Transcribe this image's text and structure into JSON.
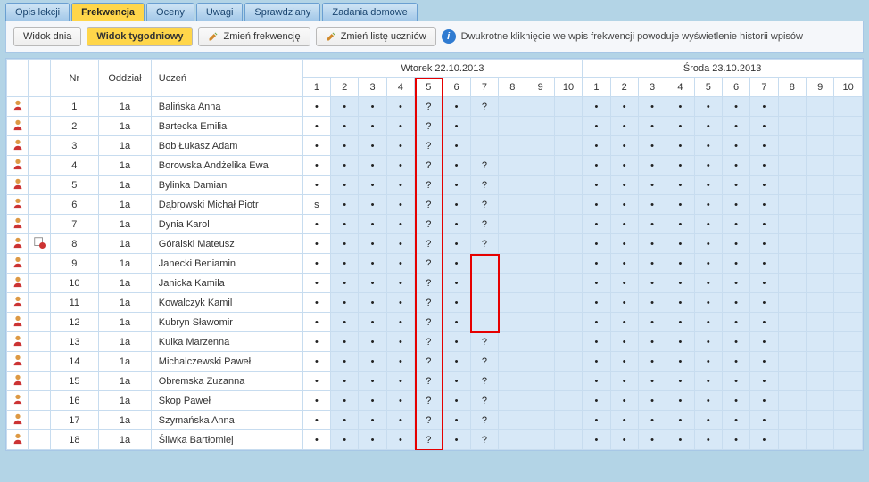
{
  "tabs": {
    "opis_lekcji": "Opis lekcji",
    "frekwencja": "Frekwencja",
    "oceny": "Oceny",
    "uwagi": "Uwagi",
    "sprawdziany": "Sprawdziany",
    "zadania_domowe": "Zadania domowe"
  },
  "toolbar": {
    "widok_dnia": "Widok dnia",
    "widok_tygodniowy": "Widok tygodniowy",
    "zmien_frekwencje": "Zmień frekwencję",
    "zmien_liste": "Zmień listę uczniów",
    "hint": "Dwukrotne kliknięcie we wpis frekwencji powoduje wyświetlenie historii wpisów"
  },
  "headers": {
    "nr": "Nr",
    "oddzial": "Oddział",
    "uczen": "Uczeń",
    "day1": "Wtorek 22.10.2013",
    "day2": "Środa 23.10.2013",
    "periods": [
      "1",
      "2",
      "3",
      "4",
      "5",
      "6",
      "7",
      "8",
      "9",
      "10"
    ]
  },
  "students": [
    {
      "nr": 1,
      "oddzial": "1a",
      "name": "Balińska Anna",
      "d1": [
        "•",
        "•",
        "•",
        "•",
        "?",
        "•",
        "?",
        "",
        "",
        ""
      ],
      "d2": [
        "•",
        "•",
        "•",
        "•",
        "•",
        "•",
        "•",
        "",
        "",
        ""
      ]
    },
    {
      "nr": 2,
      "oddzial": "1a",
      "name": "Bartecka Emilia",
      "d1": [
        "•",
        "•",
        "•",
        "•",
        "?",
        "•",
        "",
        "",
        "",
        ""
      ],
      "d2": [
        "•",
        "•",
        "•",
        "•",
        "•",
        "•",
        "•",
        "",
        "",
        ""
      ]
    },
    {
      "nr": 3,
      "oddzial": "1a",
      "name": "Bob Łukasz Adam",
      "d1": [
        "•",
        "•",
        "•",
        "•",
        "?",
        "•",
        "",
        "",
        "",
        ""
      ],
      "d2": [
        "•",
        "•",
        "•",
        "•",
        "•",
        "•",
        "•",
        "",
        "",
        ""
      ]
    },
    {
      "nr": 4,
      "oddzial": "1a",
      "name": "Borowska Andżelika Ewa",
      "d1": [
        "•",
        "•",
        "•",
        "•",
        "?",
        "•",
        "?",
        "",
        "",
        ""
      ],
      "d2": [
        "•",
        "•",
        "•",
        "•",
        "•",
        "•",
        "•",
        "",
        "",
        ""
      ]
    },
    {
      "nr": 5,
      "oddzial": "1a",
      "name": "Bylinka Damian",
      "d1": [
        "•",
        "•",
        "•",
        "•",
        "?",
        "•",
        "?",
        "",
        "",
        ""
      ],
      "d2": [
        "•",
        "•",
        "•",
        "•",
        "•",
        "•",
        "•",
        "",
        "",
        ""
      ]
    },
    {
      "nr": 6,
      "oddzial": "1a",
      "name": "Dąbrowski Michał Piotr",
      "d1": [
        "s",
        "•",
        "•",
        "•",
        "?",
        "•",
        "?",
        "",
        "",
        ""
      ],
      "d2": [
        "•",
        "•",
        "•",
        "•",
        "•",
        "•",
        "•",
        "",
        "",
        ""
      ]
    },
    {
      "nr": 7,
      "oddzial": "1a",
      "name": "Dynia Karol",
      "d1": [
        "•",
        "•",
        "•",
        "•",
        "?",
        "•",
        "?",
        "",
        "",
        ""
      ],
      "d2": [
        "•",
        "•",
        "•",
        "•",
        "•",
        "•",
        "•",
        "",
        "",
        ""
      ]
    },
    {
      "nr": 8,
      "oddzial": "1a",
      "name": "Góralski Mateusz",
      "d1": [
        "•",
        "•",
        "•",
        "•",
        "?",
        "•",
        "?",
        "",
        "",
        ""
      ],
      "d2": [
        "•",
        "•",
        "•",
        "•",
        "•",
        "•",
        "•",
        "",
        "",
        ""
      ],
      "flag": true
    },
    {
      "nr": 9,
      "oddzial": "1a",
      "name": "Janecki Beniamin",
      "d1": [
        "•",
        "•",
        "•",
        "•",
        "?",
        "•",
        "",
        "",
        "",
        ""
      ],
      "d2": [
        "•",
        "•",
        "•",
        "•",
        "•",
        "•",
        "•",
        "",
        "",
        ""
      ]
    },
    {
      "nr": 10,
      "oddzial": "1a",
      "name": "Janicka Kamila",
      "d1": [
        "•",
        "•",
        "•",
        "•",
        "?",
        "•",
        "",
        "",
        "",
        ""
      ],
      "d2": [
        "•",
        "•",
        "•",
        "•",
        "•",
        "•",
        "•",
        "",
        "",
        ""
      ]
    },
    {
      "nr": 11,
      "oddzial": "1a",
      "name": "Kowalczyk Kamil",
      "d1": [
        "•",
        "•",
        "•",
        "•",
        "?",
        "•",
        "",
        "",
        "",
        ""
      ],
      "d2": [
        "•",
        "•",
        "•",
        "•",
        "•",
        "•",
        "•",
        "",
        "",
        ""
      ]
    },
    {
      "nr": 12,
      "oddzial": "1a",
      "name": "Kubryn Sławomir",
      "d1": [
        "•",
        "•",
        "•",
        "•",
        "?",
        "•",
        "",
        "",
        "",
        ""
      ],
      "d2": [
        "•",
        "•",
        "•",
        "•",
        "•",
        "•",
        "•",
        "",
        "",
        ""
      ]
    },
    {
      "nr": 13,
      "oddzial": "1a",
      "name": "Kulka Marzenna",
      "d1": [
        "•",
        "•",
        "•",
        "•",
        "?",
        "•",
        "?",
        "",
        "",
        ""
      ],
      "d2": [
        "•",
        "•",
        "•",
        "•",
        "•",
        "•",
        "•",
        "",
        "",
        ""
      ]
    },
    {
      "nr": 14,
      "oddzial": "1a",
      "name": "Michalczewski Paweł",
      "d1": [
        "•",
        "•",
        "•",
        "•",
        "?",
        "•",
        "?",
        "",
        "",
        ""
      ],
      "d2": [
        "•",
        "•",
        "•",
        "•",
        "•",
        "•",
        "•",
        "",
        "",
        ""
      ]
    },
    {
      "nr": 15,
      "oddzial": "1a",
      "name": "Obremska Zuzanna",
      "d1": [
        "•",
        "•",
        "•",
        "•",
        "?",
        "•",
        "?",
        "",
        "",
        ""
      ],
      "d2": [
        "•",
        "•",
        "•",
        "•",
        "•",
        "•",
        "•",
        "",
        "",
        ""
      ]
    },
    {
      "nr": 16,
      "oddzial": "1a",
      "name": "Skop Paweł",
      "d1": [
        "•",
        "•",
        "•",
        "•",
        "?",
        "•",
        "?",
        "",
        "",
        ""
      ],
      "d2": [
        "•",
        "•",
        "•",
        "•",
        "•",
        "•",
        "•",
        "",
        "",
        ""
      ]
    },
    {
      "nr": 17,
      "oddzial": "1a",
      "name": "Szymańska Anna",
      "d1": [
        "•",
        "•",
        "•",
        "•",
        "?",
        "•",
        "?",
        "",
        "",
        ""
      ],
      "d2": [
        "•",
        "•",
        "•",
        "•",
        "•",
        "•",
        "•",
        "",
        "",
        ""
      ]
    },
    {
      "nr": 18,
      "oddzial": "1a",
      "name": "Śliwka Bartłomiej",
      "d1": [
        "•",
        "•",
        "•",
        "•",
        "?",
        "•",
        "?",
        "",
        "",
        ""
      ],
      "d2": [
        "•",
        "•",
        "•",
        "•",
        "•",
        "•",
        "•",
        "",
        "",
        ""
      ]
    }
  ]
}
